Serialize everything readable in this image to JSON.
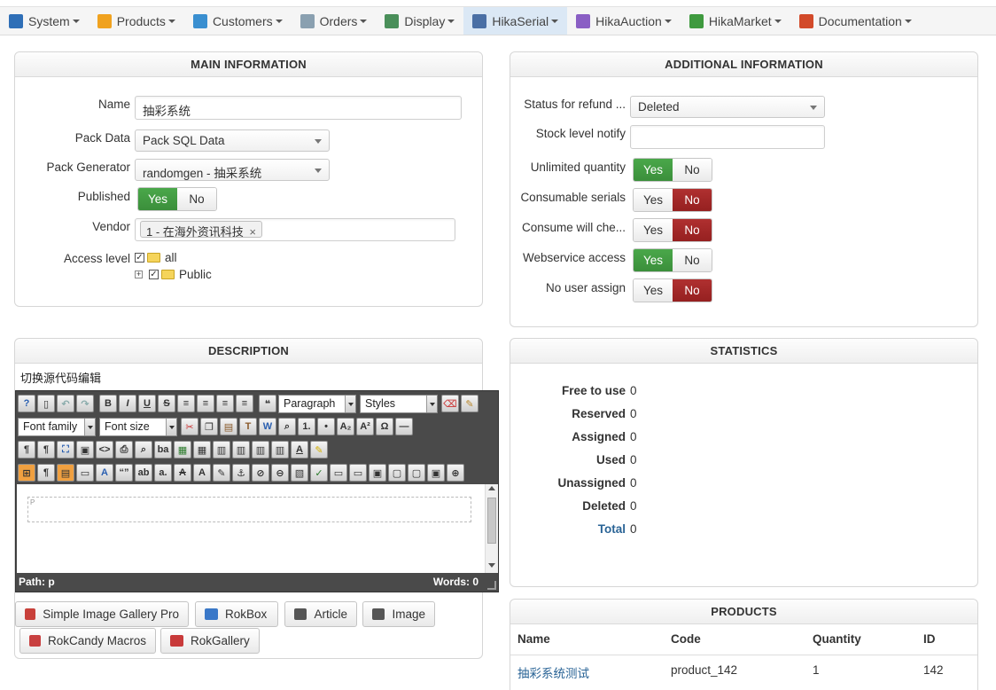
{
  "menu": [
    {
      "label": "System",
      "icon": "wrench-icon",
      "color": "#2f6fb7"
    },
    {
      "label": "Products",
      "icon": "box-icon",
      "color": "#f0a21f"
    },
    {
      "label": "Customers",
      "icon": "users-icon",
      "color": "#3a8fd0"
    },
    {
      "label": "Orders",
      "icon": "pencil-doc-icon",
      "color": "#8aa0b0"
    },
    {
      "label": "Display",
      "icon": "display-icon",
      "color": "#4a8f5a"
    },
    {
      "label": "HikaSerial",
      "icon": "serial-icon",
      "color": "#4a6fa5"
    },
    {
      "label": "HikaAuction",
      "icon": "auction-icon",
      "color": "#8a5fc4"
    },
    {
      "label": "HikaMarket",
      "icon": "market-icon",
      "color": "#3f9a3f"
    },
    {
      "label": "Documentation",
      "icon": "lifebuoy-icon",
      "color": "#d24a2a"
    }
  ],
  "main_info": {
    "title": "MAIN INFORMATION",
    "name_label": "Name",
    "name_value": "抽彩系统",
    "pack_data_label": "Pack Data",
    "pack_data_value": "Pack SQL Data",
    "pack_generator_label": "Pack Generator",
    "pack_generator_value": "randomgen - 抽采系统",
    "published_label": "Published",
    "yes": "Yes",
    "no": "No",
    "vendor_label": "Vendor",
    "vendor_tag": "1 - 在海外资讯科技",
    "access_label": "Access level",
    "access_all": "all",
    "access_public": "Public"
  },
  "additional_info": {
    "title": "ADDITIONAL INFORMATION",
    "status_refund_label": "Status for refund ...",
    "status_refund_value": "Deleted",
    "stock_notify_label": "Stock level notify",
    "stock_notify_value": "",
    "rows": [
      {
        "label": "Unlimited quantity",
        "state": "yes"
      },
      {
        "label": "Consumable serials",
        "state": "no"
      },
      {
        "label": "Consume will che...",
        "state": "no"
      },
      {
        "label": "Webservice access",
        "state": "yes"
      },
      {
        "label": "No user assign",
        "state": "no"
      }
    ],
    "yes": "Yes",
    "no": "No"
  },
  "description": {
    "title": "DESCRIPTION",
    "toggle_source": "切换源代码编辑",
    "format_select": "Paragraph",
    "styles_select": "Styles",
    "font_family": "Font family",
    "font_size": "Font size",
    "paragraph_marker": "P",
    "path": "Path: p",
    "words": "Words: 0"
  },
  "plugins": [
    {
      "label": "Simple Image Gallery Pro",
      "icon": "gallery-icon",
      "color": "#c8403a"
    },
    {
      "label": "RokBox",
      "icon": "rokbox-icon",
      "color": "#3a78c8"
    },
    {
      "label": "Article",
      "icon": "article-icon",
      "color": "#555555"
    },
    {
      "label": "Image",
      "icon": "image-icon",
      "color": "#555555"
    },
    {
      "label": "RokCandy Macros",
      "icon": "rokcandy-icon",
      "color": "#c84040"
    },
    {
      "label": "RokGallery",
      "icon": "rokgallery-icon",
      "color": "#c83a3a"
    }
  ],
  "statistics": {
    "title": "STATISTICS",
    "rows": [
      {
        "label": "Free to use",
        "value": "0"
      },
      {
        "label": "Reserved",
        "value": "0"
      },
      {
        "label": "Assigned",
        "value": "0"
      },
      {
        "label": "Used",
        "value": "0"
      },
      {
        "label": "Unassigned",
        "value": "0"
      },
      {
        "label": "Deleted",
        "value": "0"
      },
      {
        "label": "Total",
        "value": "0"
      }
    ]
  },
  "products": {
    "title": "PRODUCTS",
    "headers": {
      "name": "Name",
      "code": "Code",
      "quantity": "Quantity",
      "id": "ID"
    },
    "rows": [
      {
        "name": "抽彩系统测试",
        "code": "product_142",
        "quantity": "1",
        "id": "142"
      }
    ]
  }
}
